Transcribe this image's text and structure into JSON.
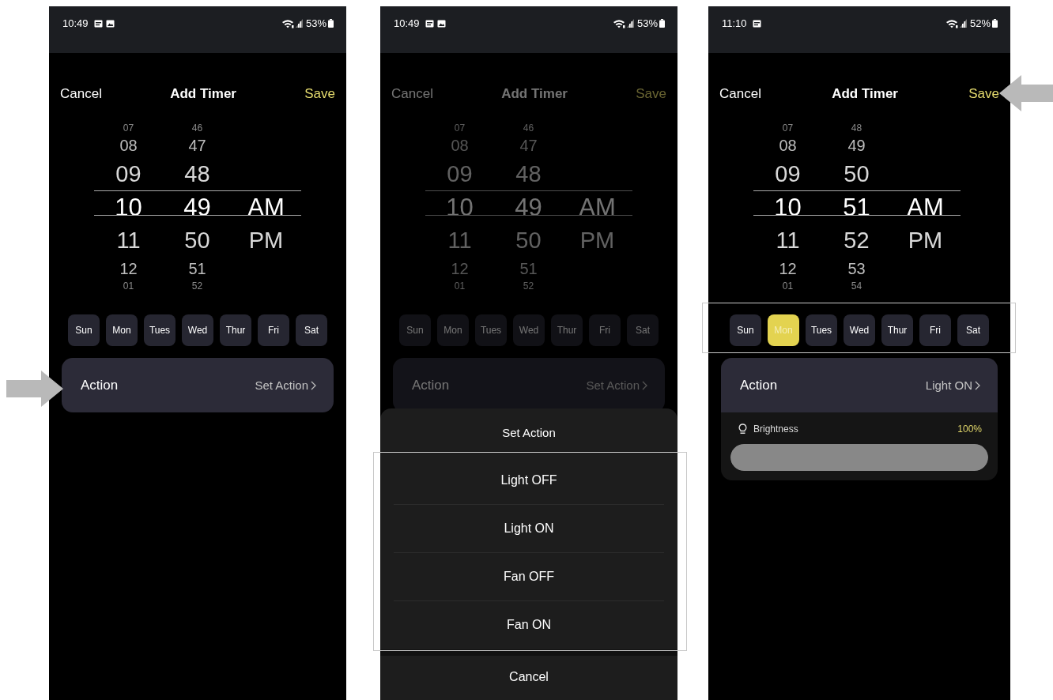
{
  "screens": [
    {
      "status_bar": {
        "time": "10:49",
        "notification_icons": [
          {
            "kind": "note"
          },
          {
            "kind": "picture"
          }
        ],
        "battery": "53%"
      },
      "header": {
        "cancel": "Cancel",
        "title": "Add Timer",
        "save": "Save"
      },
      "picker": {
        "columns": [
          {
            "items": [
              {
                "text": "07",
                "selected": false
              },
              {
                "text": "08",
                "selected": false
              },
              {
                "text": "09",
                "selected": false
              },
              {
                "text": "10",
                "selected": true
              },
              {
                "text": "11",
                "selected": false
              },
              {
                "text": "12",
                "selected": false
              },
              {
                "text": "01",
                "selected": false
              }
            ]
          },
          {
            "items": [
              {
                "text": "46",
                "selected": false
              },
              {
                "text": "47",
                "selected": false
              },
              {
                "text": "48",
                "selected": false
              },
              {
                "text": "49",
                "selected": true
              },
              {
                "text": "50",
                "selected": false
              },
              {
                "text": "51",
                "selected": false
              },
              {
                "text": "52",
                "selected": false
              }
            ]
          },
          {
            "items": [
              {
                "text": "AM",
                "selected": true
              },
              {
                "text": "PM",
                "selected": false
              }
            ]
          }
        ]
      },
      "days": [
        {
          "label": "Sun",
          "selected": false
        },
        {
          "label": "Mon",
          "selected": false
        },
        {
          "label": "Tues",
          "selected": false
        },
        {
          "label": "Wed",
          "selected": false
        },
        {
          "label": "Thur",
          "selected": false
        },
        {
          "label": "Fri",
          "selected": false
        },
        {
          "label": "Sat",
          "selected": false
        }
      ],
      "action": {
        "label": "Action",
        "value": "Set Action",
        "arrow": true
      }
    },
    {
      "status_bar": {
        "time": "10:49",
        "notification_icons": [
          {
            "kind": "note"
          },
          {
            "kind": "picture"
          }
        ],
        "battery": "53%"
      },
      "header": {
        "cancel": "Cancel",
        "title": "Add Timer",
        "save": "Save"
      },
      "picker": {
        "columns": [
          {
            "items": [
              {
                "text": "07",
                "selected": false
              },
              {
                "text": "08",
                "selected": false
              },
              {
                "text": "09",
                "selected": false
              },
              {
                "text": "10",
                "selected": true
              },
              {
                "text": "11",
                "selected": false
              },
              {
                "text": "12",
                "selected": false
              },
              {
                "text": "01",
                "selected": false
              }
            ]
          },
          {
            "items": [
              {
                "text": "46",
                "selected": false
              },
              {
                "text": "47",
                "selected": false
              },
              {
                "text": "48",
                "selected": false
              },
              {
                "text": "49",
                "selected": true
              },
              {
                "text": "50",
                "selected": false
              },
              {
                "text": "51",
                "selected": false
              },
              {
                "text": "52",
                "selected": false
              }
            ]
          },
          {
            "items": [
              {
                "text": "AM",
                "selected": true
              },
              {
                "text": "PM",
                "selected": false
              }
            ]
          }
        ]
      },
      "days": [
        {
          "label": "Sun",
          "selected": false
        },
        {
          "label": "Mon",
          "selected": false
        },
        {
          "label": "Tues",
          "selected": false
        },
        {
          "label": "Wed",
          "selected": false
        },
        {
          "label": "Thur",
          "selected": false
        },
        {
          "label": "Fri",
          "selected": false
        },
        {
          "label": "Sat",
          "selected": false
        }
      ],
      "action": {
        "label": "Action",
        "value": "Set Action"
      },
      "dimmed": true,
      "action_sheet": {
        "title": "Set Action",
        "options": [
          "Light OFF",
          "Light ON",
          "Fan OFF",
          "Fan ON"
        ],
        "cancel": "Cancel",
        "options_highlighted": true
      }
    },
    {
      "status_bar": {
        "time": "11:10",
        "notification_icons": [
          {
            "kind": "note"
          }
        ],
        "battery": "52%"
      },
      "header": {
        "cancel": "Cancel",
        "title": "Add Timer",
        "save": "Save"
      },
      "picker": {
        "columns": [
          {
            "items": [
              {
                "text": "07",
                "selected": false
              },
              {
                "text": "08",
                "selected": false
              },
              {
                "text": "09",
                "selected": false
              },
              {
                "text": "10",
                "selected": true
              },
              {
                "text": "11",
                "selected": false
              },
              {
                "text": "12",
                "selected": false
              },
              {
                "text": "01",
                "selected": false
              }
            ]
          },
          {
            "items": [
              {
                "text": "48",
                "selected": false
              },
              {
                "text": "49",
                "selected": false
              },
              {
                "text": "50",
                "selected": false
              },
              {
                "text": "51",
                "selected": true
              },
              {
                "text": "52",
                "selected": false
              },
              {
                "text": "53",
                "selected": false
              },
              {
                "text": "54",
                "selected": false
              }
            ]
          },
          {
            "items": [
              {
                "text": "AM",
                "selected": true
              },
              {
                "text": "PM",
                "selected": false
              }
            ]
          }
        ]
      },
      "days": [
        {
          "label": "Sun",
          "selected": false
        },
        {
          "label": "Mon",
          "selected": true
        },
        {
          "label": "Tues",
          "selected": false
        },
        {
          "label": "Wed",
          "selected": false
        },
        {
          "label": "Thur",
          "selected": false
        },
        {
          "label": "Fri",
          "selected": false
        },
        {
          "label": "Sat",
          "selected": false
        }
      ],
      "action": {
        "label": "Action",
        "value": "Light ON"
      },
      "brightness": {
        "label": "Brightness",
        "reading": "100%",
        "level": 1
      },
      "save_arrow": true,
      "days_highlighted": true
    }
  ]
}
